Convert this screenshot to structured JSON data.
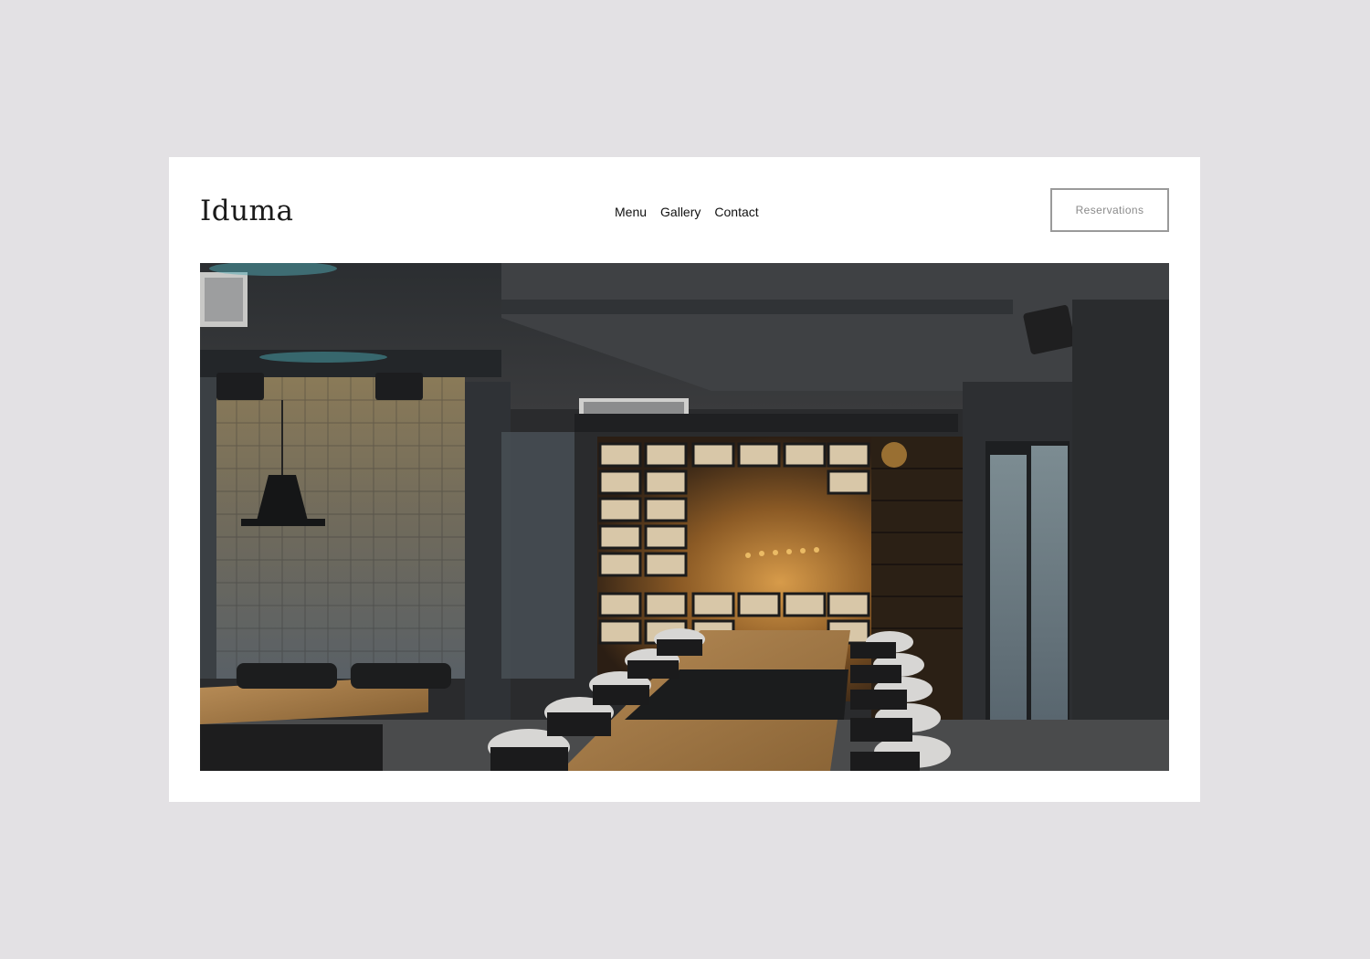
{
  "brand": {
    "logo_text": "Iduma"
  },
  "nav": {
    "items": [
      {
        "label": "Menu"
      },
      {
        "label": "Gallery"
      },
      {
        "label": "Contact"
      }
    ]
  },
  "header": {
    "cta_label": "Reservations"
  },
  "colors": {
    "page_background": "#e3e1e4",
    "card_background": "#ffffff",
    "text": "#111111",
    "button_border": "#9a9a9a",
    "button_text": "#8a8a8a"
  },
  "hero": {
    "image_semantic": "restaurant-interior-photo"
  }
}
